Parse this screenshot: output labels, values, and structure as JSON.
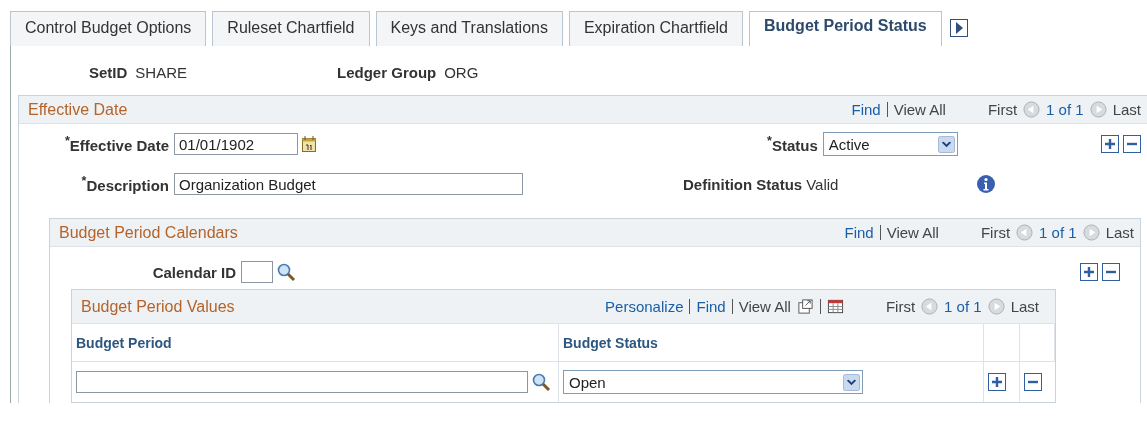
{
  "tabs": [
    {
      "label": "Control Budget Options",
      "selected": false
    },
    {
      "label": "Ruleset Chartfield",
      "selected": false
    },
    {
      "label": "Keys and Translations",
      "selected": false
    },
    {
      "label": "Expiration Chartfield",
      "selected": false
    },
    {
      "label": "Budget Period Status",
      "selected": true
    }
  ],
  "header_fields": [
    {
      "label": "SetID",
      "value": "SHARE"
    },
    {
      "label": "Ledger Group",
      "value": "ORG"
    }
  ],
  "effective_date_panel": {
    "title": "Effective Date",
    "nav": {
      "find": "Find",
      "view_all": "View All",
      "first": "First",
      "count": "1 of 1",
      "last": "Last"
    },
    "effective_date": {
      "label": "$^{*}$Effective Date",
      "value": "01/01/1902"
    },
    "status": {
      "label": "$^{*}$Status",
      "value": "Active"
    },
    "description": {
      "label": "$^{*}$Description",
      "value": "Organization Budget"
    },
    "definition_status": {
      "label": "Definition Status",
      "value": "Valid"
    },
    "calendars_panel": {
      "title": "Budget Period Calendars",
      "nav": {
        "find": "Find",
        "view_all": "View All",
        "first": "First",
        "count": "1 of 1",
        "last": "Last"
      },
      "calendar_id_label": "Calendar ID",
      "values_grid": {
        "title": "Budget Period Values",
        "nav": {
          "personalize": "Personalize",
          "find": "Find",
          "view_all": "View All",
          "first": "First",
          "count": "1 of 1",
          "last": "Last"
        },
        "columns": [
          "Budget Period",
          "Budget Status"
        ],
        "rows": [
          {
            "budget_status": "Open"
          }
        ]
      }
    }
  }
}
